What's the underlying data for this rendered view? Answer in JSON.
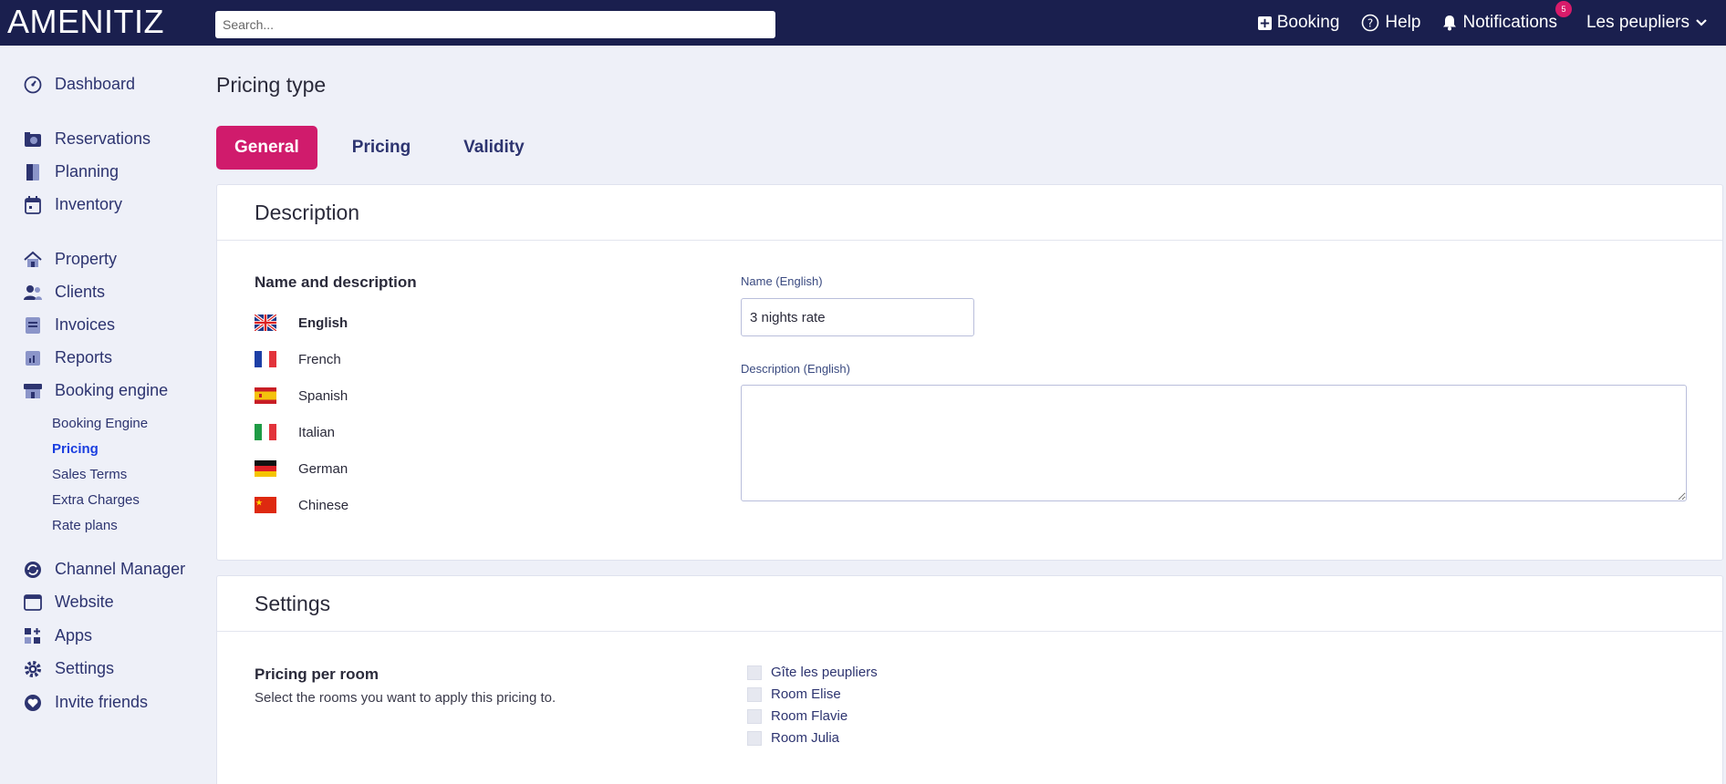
{
  "topbar": {
    "logo": "AMENITIZ",
    "search_placeholder": "Search...",
    "booking_label": "Booking",
    "help_label": "Help",
    "notifications_label": "Notifications",
    "notifications_count": "5",
    "property_label": "Les peupliers"
  },
  "sidebar": {
    "dashboard": "Dashboard",
    "reservations": "Reservations",
    "planning": "Planning",
    "inventory": "Inventory",
    "property": "Property",
    "clients": "Clients",
    "invoices": "Invoices",
    "reports": "Reports",
    "booking_engine": "Booking engine",
    "sub": {
      "booking_engine": "Booking Engine",
      "pricing": "Pricing",
      "sales_terms": "Sales Terms",
      "extra_charges": "Extra Charges",
      "rate_plans": "Rate plans"
    },
    "channel_manager": "Channel Manager",
    "website": "Website",
    "apps": "Apps",
    "settings": "Settings",
    "invite_friends": "Invite friends"
  },
  "page": {
    "title": "Pricing type",
    "tabs": [
      "General",
      "Pricing",
      "Validity"
    ]
  },
  "description_card": {
    "title": "Description",
    "section_label": "Name and description",
    "languages": [
      "English",
      "French",
      "Spanish",
      "Italian",
      "German",
      "Chinese"
    ],
    "name_label": "Name (English)",
    "name_value": "3 nights rate",
    "description_label": "Description (English)",
    "description_value": ""
  },
  "settings_card": {
    "title": "Settings",
    "section_label": "Pricing per room",
    "section_desc": "Select the rooms you want to apply this pricing to.",
    "rooms": [
      "Gîte les peupliers",
      "Room Elise",
      "Room Flavie",
      "Room Julia"
    ]
  },
  "colors": {
    "topbar_bg": "#1a1f4e",
    "accent": "#d01b6c",
    "nav_text": "#2d3470",
    "active_link": "#1a3ee0",
    "page_bg": "#eef0f8"
  }
}
